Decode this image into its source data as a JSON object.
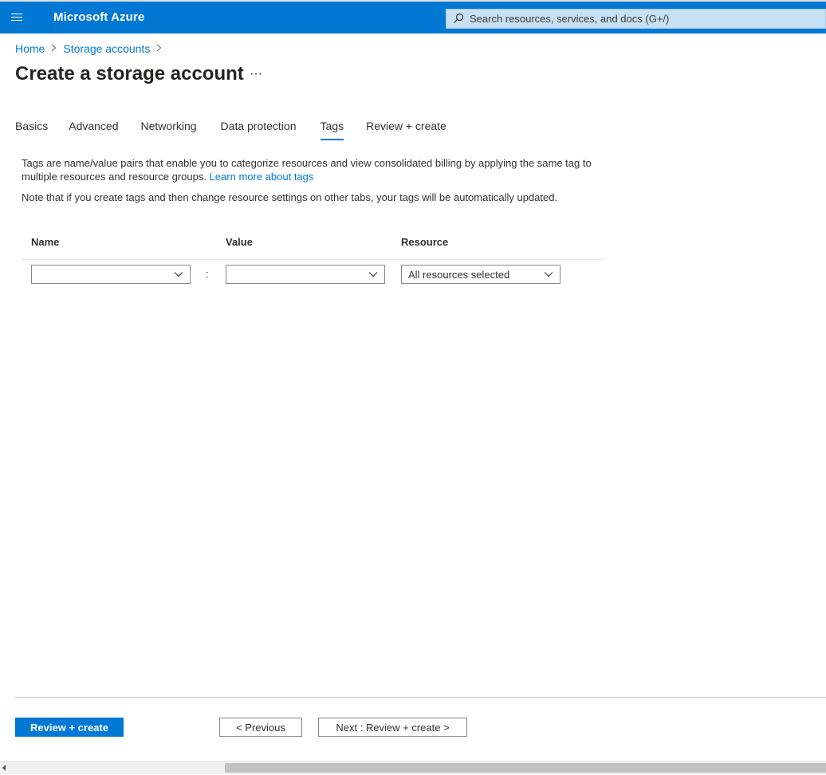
{
  "header": {
    "brand": "Microsoft Azure",
    "search_placeholder": "Search resources, services, and docs (G+/)",
    "bar_color": "#0078d4"
  },
  "breadcrumb": {
    "items": [
      "Home",
      "Storage accounts"
    ]
  },
  "page": {
    "title": "Create a storage account",
    "more": "···"
  },
  "tabs": [
    {
      "label": "Basics"
    },
    {
      "label": "Advanced"
    },
    {
      "label": "Networking"
    },
    {
      "label": "Data protection"
    },
    {
      "label": "Tags",
      "active": true
    },
    {
      "label": "Review + create"
    }
  ],
  "tags_section": {
    "description": "Tags are name/value pairs that enable you to categorize resources and view consolidated billing by applying the same tag to multiple resources and resource groups.",
    "learn_more": "Learn more about tags",
    "note": "Note that if you create tags and then change resource settings on other tabs, your tags will be automatically updated.",
    "columns": {
      "name": "Name",
      "value": "Value",
      "resource": "Resource"
    },
    "row": {
      "name_value": "",
      "separator": ":",
      "value_value": "",
      "resource_value": "All resources selected"
    }
  },
  "footer": {
    "review_create": "Review + create",
    "previous": "< Previous",
    "next": "Next : Review + create >"
  }
}
